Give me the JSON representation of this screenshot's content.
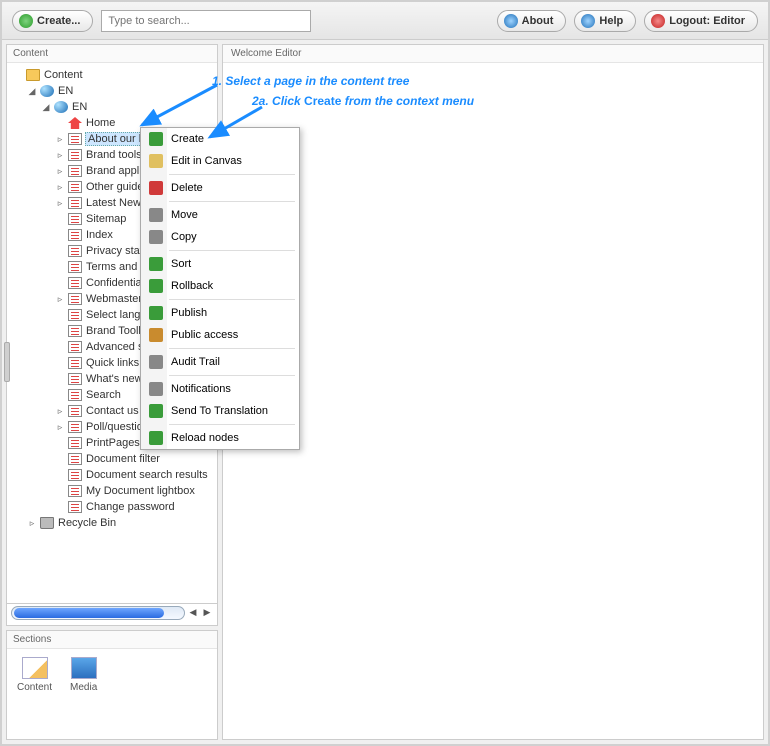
{
  "toolbar": {
    "create_label": "Create...",
    "search_placeholder": "Type to search...",
    "about_label": "About",
    "help_label": "Help",
    "logout_label": "Logout: Editor"
  },
  "panels": {
    "content_title": "Content",
    "sections_title": "Sections",
    "welcome_title": "Welcome Editor"
  },
  "tree": {
    "root": "Content",
    "en1": "EN",
    "en2": "EN",
    "items": [
      "Home",
      "About our brand",
      "Brand tools",
      "Brand applications",
      "Other guidelines",
      "Latest News",
      "Sitemap",
      "Index",
      "Privacy statement",
      "Terms and conditions",
      "Confidentiality",
      "Webmaster",
      "Select language",
      "Brand Toolbox",
      "Advanced search",
      "Quick links",
      "What's new",
      "Search",
      "Contact us",
      "Poll/question",
      "PrintPages",
      "Document filter",
      "Document search results",
      "My Document lightbox",
      "Change password"
    ],
    "recycle": "Recycle Bin"
  },
  "context_menu": {
    "items": [
      "Create",
      "Edit in Canvas",
      "Delete",
      "Move",
      "Copy",
      "Sort",
      "Rollback",
      "Publish",
      "Public access",
      "Audit Trail",
      "Notifications",
      "Send To Translation",
      "Reload nodes"
    ]
  },
  "sections": {
    "content": "Content",
    "media": "Media"
  },
  "annotations": {
    "step1_prefix": "1.",
    "step1_text": "Select a page in the content tree",
    "step2_prefix": "2a.",
    "step2_text_a": "Click ",
    "step2_bold": "Create",
    "step2_text_b": " from the context menu"
  },
  "ctx_icon_colors": [
    "#3a9c3a",
    "#e0c060",
    "#d03a3a",
    "#888888",
    "#888888",
    "#3a9c3a",
    "#3a9c3a",
    "#3a9c3a",
    "#c98b2e",
    "#888888",
    "#888888",
    "#3a9c3a",
    "#3a9c3a"
  ]
}
